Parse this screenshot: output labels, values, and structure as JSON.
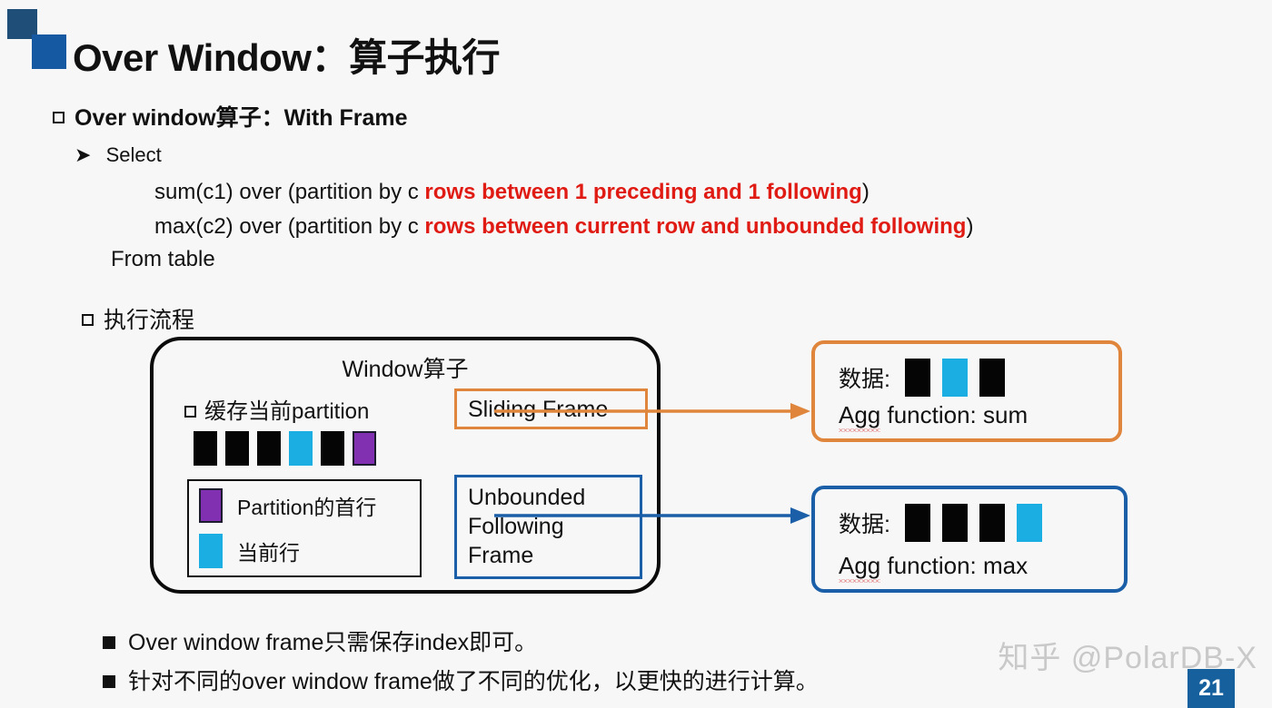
{
  "slide": {
    "title": "Over Window：算子执行",
    "page_number": "21",
    "watermark": "知乎 @PolarDB-X",
    "background_color": "#f7f7f7"
  },
  "logo": {
    "square_top_color": "#1F4E79",
    "square_bottom_color": "#1559A3"
  },
  "section_with_frame": {
    "heading": "Over window算子：With Frame",
    "select_label": "Select",
    "code_lines": [
      {
        "plain_prefix": "sum(c1) over (partition by c ",
        "highlight": "rows between 1 preceding and 1 following",
        "plain_suffix": ")"
      },
      {
        "plain_prefix": "max(c2) over (partition by c ",
        "highlight": "rows between current row and unbounded following",
        "plain_suffix": ")"
      }
    ],
    "from_line": "From table",
    "highlight_color": "#E01B14"
  },
  "section_flow": {
    "heading": "执行流程"
  },
  "window_operator": {
    "title": "Window算子",
    "cache_label": "缓存当前partition",
    "row_blocks": [
      "black",
      "black",
      "black",
      "cyan",
      "black",
      "purple"
    ],
    "legend": [
      {
        "swatch": "purple",
        "label": "Partition的首行"
      },
      {
        "swatch": "cyan",
        "label": "当前行"
      }
    ],
    "sliding_frame_label": "Sliding Frame",
    "unbounded_frame_label": "Unbounded\nFollowing\nFrame",
    "sliding_frame_color": "#E0853C",
    "unbounded_frame_color": "#1B5FA8"
  },
  "results": [
    {
      "data_label": "数据:",
      "blocks": [
        "black",
        "cyan",
        "black"
      ],
      "agg_prefix": "Agg",
      "agg_text": " function: sum",
      "border_color": "#E0853C"
    },
    {
      "data_label": "数据:",
      "blocks": [
        "black",
        "black",
        "black",
        "cyan"
      ],
      "agg_prefix": "Agg",
      "agg_text": " function: max",
      "border_color": "#1B5FA8"
    }
  ],
  "bottom_notes": [
    "Over window frame只需保存index即可。",
    "针对不同的over window frame做了不同的优化，以更快的进行计算。"
  ],
  "palette": {
    "black_block": "#050505",
    "cyan_block": "#1BAEE3",
    "purple_block": "#8030B0"
  }
}
